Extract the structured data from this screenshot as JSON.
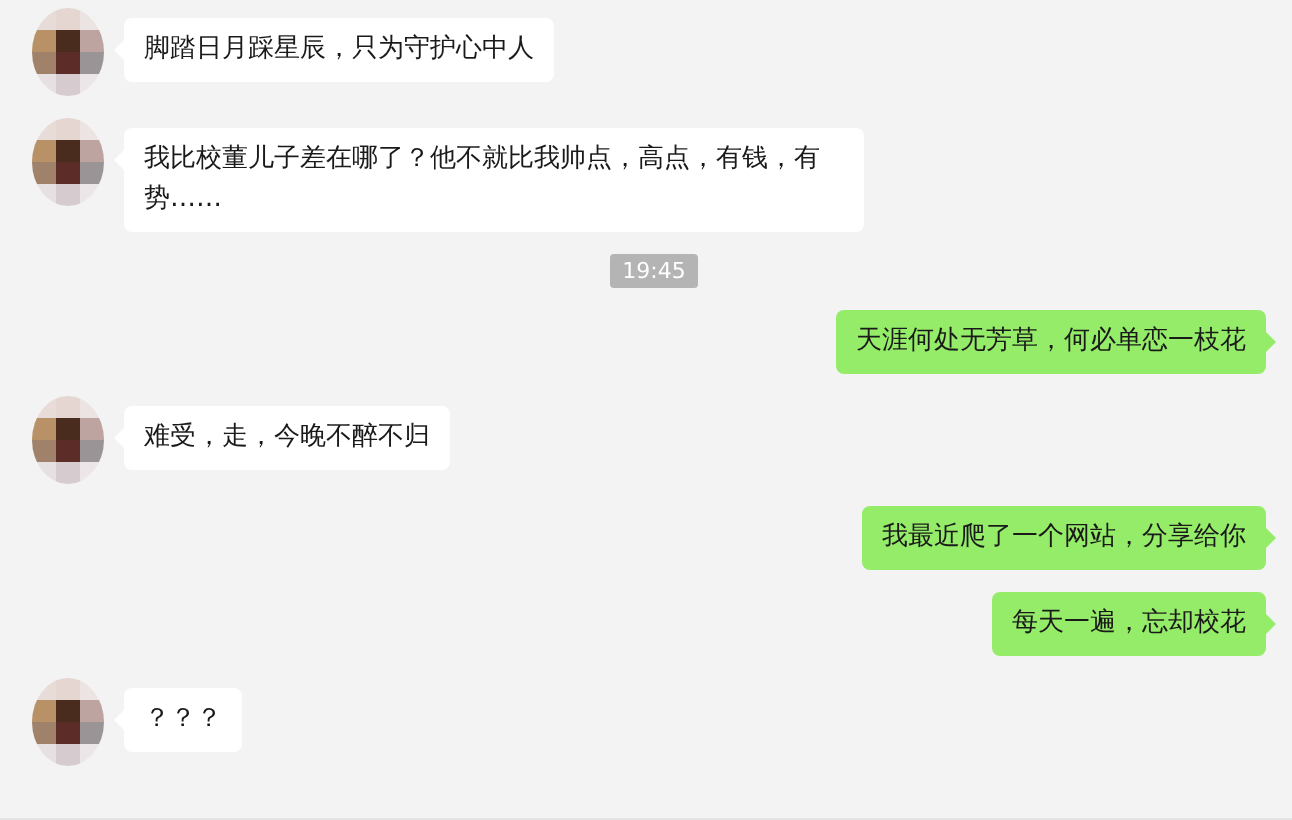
{
  "messages": [
    {
      "kind": "incoming",
      "text": "脚踏日月踩星辰，只为守护心中人"
    },
    {
      "kind": "incoming",
      "text": "我比校董儿子差在哪了？他不就比我帅点，高点，有钱，有势……"
    },
    {
      "kind": "time",
      "text": "19:45"
    },
    {
      "kind": "outgoing",
      "text": "天涯何处无芳草，何必单恋一枝花"
    },
    {
      "kind": "incoming",
      "text": "难受，走，今晚不醉不归"
    },
    {
      "kind": "outgoing",
      "text": "我最近爬了一个网站，分享给你"
    },
    {
      "kind": "outgoing",
      "text": "每天一遍，忘却校花"
    },
    {
      "kind": "incoming",
      "text": "？？？"
    }
  ]
}
